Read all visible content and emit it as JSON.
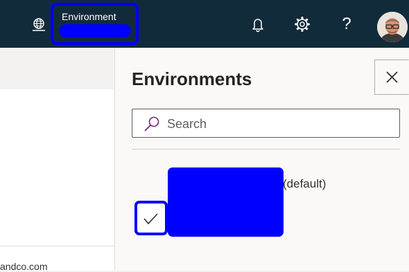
{
  "topbar": {
    "environment_label": "Environment",
    "icons": {
      "environment": "globe-icon",
      "notifications": "bell-icon",
      "settings": "gear-icon",
      "help": "help-icon"
    },
    "help_glyph": "?"
  },
  "left": {
    "footer_text": "andco.com"
  },
  "panel": {
    "title": "Environments",
    "search_placeholder": "Search",
    "environments": [
      {
        "suffix": "(default)",
        "selected": true
      }
    ]
  },
  "colors": {
    "topbar_bg": "#122b3a",
    "redaction": "#0000ff",
    "search_icon": "#742774"
  }
}
